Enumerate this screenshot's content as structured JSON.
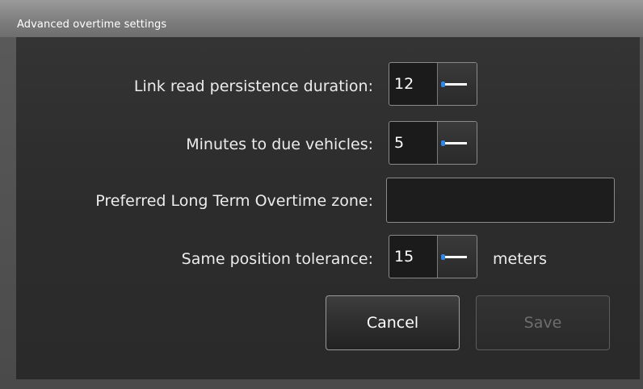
{
  "window": {
    "title": "Advanced overtime settings"
  },
  "form": {
    "link_read_persistence": {
      "label": "Link read persistence duration:",
      "value": "12"
    },
    "minutes_to_due": {
      "label": "Minutes to due vehicles:",
      "value": "5"
    },
    "preferred_zone": {
      "label": "Preferred Long Term Overtime zone:",
      "value": ""
    },
    "same_position_tolerance": {
      "label": "Same position tolerance:",
      "value": "15",
      "unit": "meters"
    }
  },
  "buttons": {
    "cancel": "Cancel",
    "save": "Save"
  },
  "colors": {
    "accent": "#2f86e8",
    "panel_background": "#2d2d2d",
    "text": "#ececec",
    "disabled_text": "#6e6e6e"
  },
  "icons": {
    "spinner_slider": "slider-handle-icon"
  }
}
